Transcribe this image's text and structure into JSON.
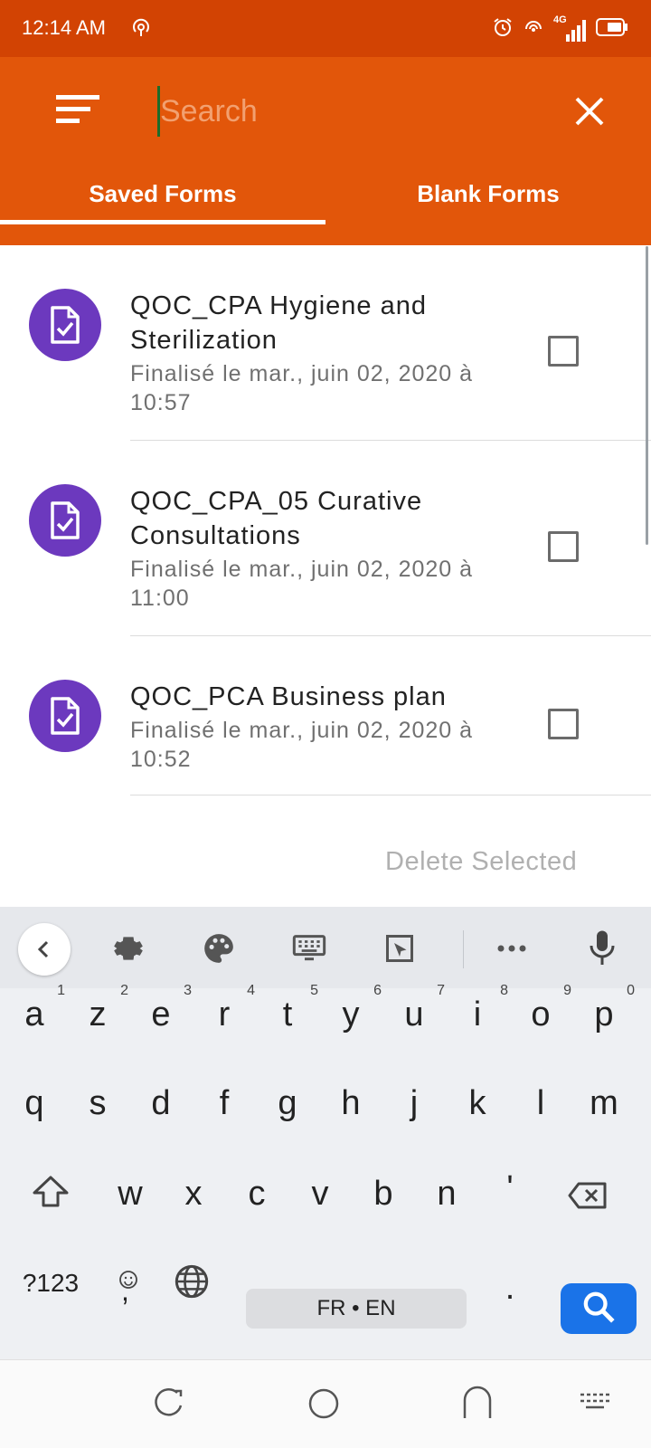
{
  "status_bar": {
    "time": "12:14 AM",
    "network": "4G"
  },
  "search": {
    "placeholder": "Search",
    "value": ""
  },
  "tabs": [
    {
      "label": "Saved Forms",
      "active": true
    },
    {
      "label": "Blank Forms",
      "active": false
    }
  ],
  "forms": [
    {
      "title": "QOC_CPA  Hygiene and Sterilization",
      "subtitle": "Finalisé le mar., juin 02, 2020 à 10:57",
      "checked": false
    },
    {
      "title": "QOC_CPA_05  Curative Consultations",
      "subtitle": "Finalisé le mar., juin 02, 2020 à 11:00",
      "checked": false
    },
    {
      "title": "QOC_PCA  Business plan",
      "subtitle": "Finalisé le mar., juin 02, 2020 à 10:52",
      "checked": false
    }
  ],
  "actions": {
    "delete_selected": "Delete Selected"
  },
  "keyboard": {
    "row1": [
      "a",
      "z",
      "e",
      "r",
      "t",
      "y",
      "u",
      "i",
      "o",
      "p"
    ],
    "row1_hints": [
      "1",
      "2",
      "3",
      "4",
      "5",
      "6",
      "7",
      "8",
      "9",
      "0"
    ],
    "row2": [
      "q",
      "s",
      "d",
      "f",
      "g",
      "h",
      "j",
      "k",
      "l",
      "m"
    ],
    "row3": [
      "w",
      "x",
      "c",
      "v",
      "b",
      "n",
      "'"
    ],
    "symbols_key": "?123",
    "comma_key": ",",
    "period_key": ".",
    "space_label": "FR • EN"
  },
  "colors": {
    "status_bar": "#d24303",
    "app_bar": "#e2560a",
    "avatar": "#6c39be",
    "enter_key": "#1a73e8"
  }
}
